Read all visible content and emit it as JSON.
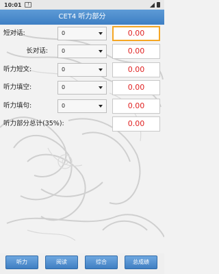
{
  "status_bar": {
    "time": "10:01",
    "warning_icon": "warning-icon"
  },
  "title": "CET4 听力部分",
  "rows": [
    {
      "label": "短对话:",
      "select_value": "0",
      "score": "0.00",
      "active": true
    },
    {
      "label": "长对话:",
      "select_value": "0",
      "score": "0.00"
    },
    {
      "label": "听力短文:",
      "select_value": "0",
      "score": "0.00"
    },
    {
      "label": "听力填空:",
      "select_value": "0",
      "score": "0.00"
    },
    {
      "label": "听力填句:",
      "select_value": "0",
      "score": "0.00"
    }
  ],
  "total": {
    "label": "听力部分总计(35%):",
    "score": "0.00"
  },
  "tabs": [
    "听力",
    "阅读",
    "综合",
    "总成绩"
  ],
  "colors": {
    "accent": "#3e7fc4",
    "score_text": "#e02020",
    "active_border": "#f5a623"
  }
}
